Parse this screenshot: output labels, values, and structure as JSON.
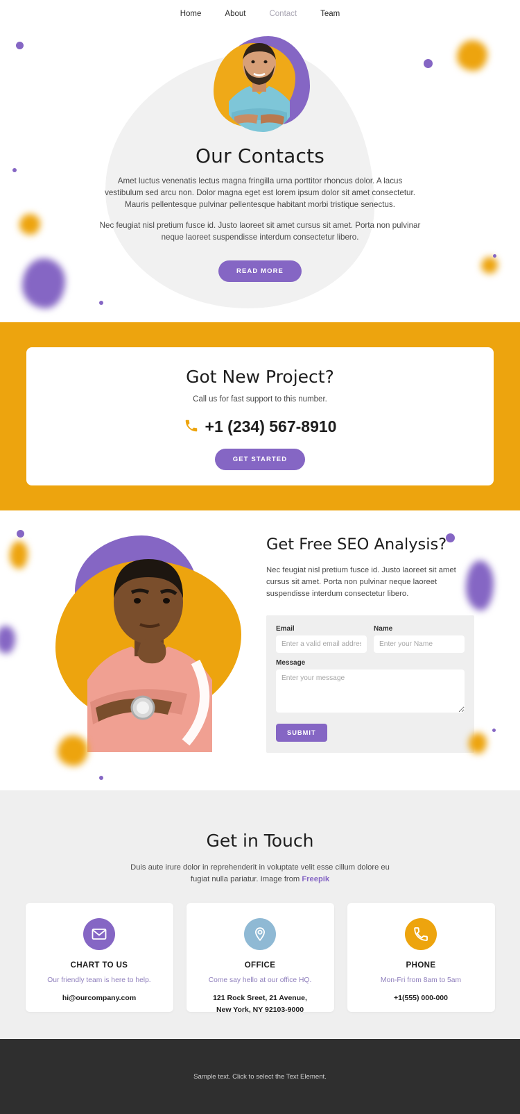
{
  "nav": {
    "items": [
      {
        "label": "Home",
        "active": false
      },
      {
        "label": "About",
        "active": false
      },
      {
        "label": "Contact",
        "active": true
      },
      {
        "label": "Team",
        "active": false
      }
    ]
  },
  "hero": {
    "title": "Our Contacts",
    "paragraph1": "Amet luctus venenatis lectus magna fringilla urna porttitor rhoncus dolor. A lacus vestibulum sed arcu non. Dolor magna eget est lorem ipsum dolor sit amet consectetur. Mauris pellentesque pulvinar pellentesque habitant morbi tristique senectus.",
    "paragraph2": "Nec feugiat nisl pretium fusce id. Justo laoreet sit amet cursus sit amet. Porta non pulvinar neque laoreet suspendisse interdum consectetur libero.",
    "button": "READ MORE"
  },
  "cta": {
    "title": "Got New Project?",
    "subtitle": "Call us for fast support to this number.",
    "phone_icon": "phone-icon",
    "phone": "+1 (234) 567-8910",
    "button": "GET STARTED"
  },
  "seo": {
    "title": "Get Free SEO Analysis?",
    "paragraph": "Nec feugiat nisl pretium fusce id. Justo laoreet sit amet cursus sit amet. Porta non pulvinar neque laoreet suspendisse interdum consectetur libero.",
    "form": {
      "email_label": "Email",
      "email_placeholder": "Enter a valid email address",
      "email_value": "",
      "name_label": "Name",
      "name_placeholder": "Enter your Name",
      "name_value": "",
      "message_label": "Message",
      "message_placeholder": "Enter your message",
      "message_value": "",
      "submit": "SUBMIT"
    }
  },
  "touch": {
    "title": "Get in Touch",
    "paragraph_line1": "Duis aute irure dolor in reprehenderit in voluptate velit esse cillum dolore eu",
    "paragraph_line2": "fugiat nulla pariatur. Image from ",
    "link": "Freepik",
    "cards": [
      {
        "icon": "envelope-icon",
        "icon_color": "#8566c4",
        "title": "CHART TO US",
        "subtitle": "Our friendly team is here to help.",
        "value_line1": "hi@ourcompany.com",
        "value_line2": ""
      },
      {
        "icon": "location-pin-icon",
        "icon_color": "#8fb9d4",
        "title": "OFFICE",
        "subtitle": "Come say hello at our office HQ.",
        "value_line1": "121 Rock Sreet, 21 Avenue,",
        "value_line2": "New York, NY 92103-9000"
      },
      {
        "icon": "phone-icon",
        "icon_color": "#eda40e",
        "title": "PHONE",
        "subtitle": "Mon-Fri from 8am to 5am",
        "value_line1": "+1(555) 000-000",
        "value_line2": ""
      }
    ]
  },
  "footer": {
    "text": "Sample text. Click to select the Text Element."
  },
  "colors": {
    "purple": "#8566c4",
    "amber": "#eda40e",
    "blue": "#8fb9d4",
    "dark": "#2f2f2f",
    "light_gray": "#efefef"
  }
}
